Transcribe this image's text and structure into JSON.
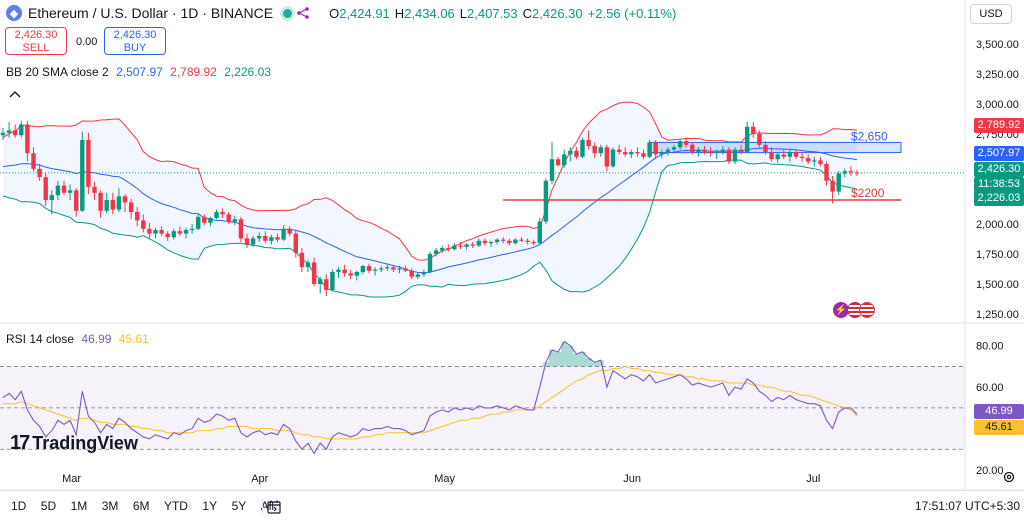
{
  "header": {
    "symbol_title": "Ethereum / U.S. Dollar · 1D · BINANCE",
    "open_label": "O",
    "open_value": "2,424.91",
    "high_label": "H",
    "high_value": "2,434.06",
    "low_label": "L",
    "low_value": "2,407.53",
    "close_label": "C",
    "close_value": "2,426.30",
    "change": "+2.56 (+0.11%)"
  },
  "trade": {
    "sell_price": "2,426.30",
    "sell_label": "SELL",
    "spread": "0.00",
    "buy_price": "2,426.30",
    "buy_label": "BUY"
  },
  "currency": "USD",
  "indicators": {
    "bb_label": "BB 20 SMA close 2",
    "bb_basis": "2,507.97",
    "bb_upper": "2,789.92",
    "bb_lower": "2,226.03",
    "rsi_label": "RSI 14 close",
    "rsi_value": "46.99",
    "rsi_ma": "45.61"
  },
  "price_tags": {
    "upper": "2,789.92",
    "basis": "2,507.97",
    "last": "2,426.30",
    "countdown": "11:38:53",
    "lower": "2,226.03"
  },
  "annotations": {
    "resistance": "$2,650",
    "support": "$2200"
  },
  "price_axis": [
    "3,500.00",
    "3,250.00",
    "3,000.00",
    "2,750.00",
    "2,250.00",
    "2,000.00",
    "1,750.00",
    "1,500.00",
    "1,250.00"
  ],
  "rsi_axis": [
    "80.00",
    "60.00",
    "20.00"
  ],
  "time_axis": [
    "Mar",
    "Apr",
    "May",
    "Jun",
    "Jul"
  ],
  "ranges": [
    "1D",
    "5D",
    "1M",
    "3M",
    "6M",
    "YTD",
    "1Y",
    "5Y",
    "All"
  ],
  "clock": "17:51:07 UTC+5:30",
  "branding": "TradingView",
  "colors": {
    "up": "#089981",
    "down": "#f23645",
    "basis": "#2962ff",
    "upper_band": "#f23645",
    "lower_band": "#089981",
    "rsi": "#7e57c2",
    "rsi_ma": "#fbc02d"
  },
  "chart_data": [
    {
      "type": "candlestick",
      "title": "Ethereum / U.S. Dollar · 1D · BINANCE",
      "ylim": [
        1200,
        3700
      ],
      "x_ticks": [
        "Mar",
        "Apr",
        "May",
        "Jun",
        "Jul"
      ],
      "start_date": "2024-02-18",
      "ohlc": [
        [
          2740,
          2800,
          2700,
          2760
        ],
        [
          2760,
          2850,
          2720,
          2780
        ],
        [
          2780,
          2830,
          2720,
          2740
        ],
        [
          2740,
          2860,
          2720,
          2830
        ],
        [
          2830,
          2860,
          2520,
          2590
        ],
        [
          2590,
          2640,
          2440,
          2460
        ],
        [
          2460,
          2500,
          2360,
          2390
        ],
        [
          2390,
          2420,
          2150,
          2200
        ],
        [
          2200,
          2280,
          2080,
          2240
        ],
        [
          2240,
          2360,
          2200,
          2320
        ],
        [
          2320,
          2360,
          2240,
          2260
        ],
        [
          2260,
          2330,
          2200,
          2280
        ],
        [
          2280,
          2300,
          2060,
          2110
        ],
        [
          2110,
          2770,
          2100,
          2700
        ],
        [
          2700,
          2760,
          2250,
          2310
        ],
        [
          2310,
          2350,
          2200,
          2260
        ],
        [
          2260,
          2280,
          2050,
          2110
        ],
        [
          2110,
          2260,
          2090,
          2200
        ],
        [
          2200,
          2260,
          2080,
          2120
        ],
        [
          2120,
          2300,
          2100,
          2230
        ],
        [
          2230,
          2250,
          2100,
          2180
        ],
        [
          2180,
          2210,
          2040,
          2100
        ],
        [
          2100,
          2140,
          1980,
          2030
        ],
        [
          2030,
          2080,
          1930,
          1960
        ],
        [
          1960,
          2010,
          1880,
          1920
        ],
        [
          1920,
          1970,
          1880,
          1950
        ],
        [
          1950,
          1980,
          1900,
          1920
        ],
        [
          1920,
          1940,
          1860,
          1890
        ],
        [
          1890,
          1960,
          1870,
          1940
        ],
        [
          1940,
          1980,
          1900,
          1920
        ],
        [
          1920,
          1970,
          1880,
          1950
        ],
        [
          1950,
          2000,
          1920,
          1960
        ],
        [
          1960,
          2080,
          1950,
          2060
        ],
        [
          2060,
          2080,
          1990,
          2010
        ],
        [
          2010,
          2060,
          1980,
          2050
        ],
        [
          2050,
          2120,
          2040,
          2100
        ],
        [
          2100,
          2130,
          2050,
          2080
        ],
        [
          2080,
          2100,
          2000,
          2020
        ],
        [
          2020,
          2070,
          1990,
          2040
        ],
        [
          2040,
          2060,
          1850,
          1880
        ],
        [
          1880,
          1920,
          1800,
          1830
        ],
        [
          1830,
          1900,
          1810,
          1880
        ],
        [
          1880,
          1930,
          1850,
          1900
        ],
        [
          1900,
          1940,
          1840,
          1860
        ],
        [
          1860,
          1910,
          1830,
          1890
        ],
        [
          1890,
          1920,
          1850,
          1870
        ],
        [
          1870,
          1990,
          1860,
          1960
        ],
        [
          1960,
          1980,
          1900,
          1920
        ],
        [
          1920,
          1950,
          1720,
          1760
        ],
        [
          1760,
          1800,
          1600,
          1640
        ],
        [
          1640,
          1700,
          1600,
          1680
        ],
        [
          1680,
          1720,
          1480,
          1500
        ],
        [
          1500,
          1560,
          1420,
          1540
        ],
        [
          1540,
          1580,
          1400,
          1450
        ],
        [
          1450,
          1620,
          1440,
          1600
        ],
        [
          1600,
          1640,
          1550,
          1620
        ],
        [
          1620,
          1660,
          1560,
          1590
        ],
        [
          1590,
          1620,
          1540,
          1570
        ],
        [
          1570,
          1610,
          1530,
          1600
        ],
        [
          1600,
          1660,
          1580,
          1650
        ],
        [
          1650,
          1670,
          1590,
          1610
        ],
        [
          1610,
          1640,
          1570,
          1620
        ],
        [
          1620,
          1650,
          1600,
          1630
        ],
        [
          1630,
          1660,
          1610,
          1640
        ],
        [
          1640,
          1660,
          1600,
          1620
        ],
        [
          1620,
          1650,
          1590,
          1630
        ],
        [
          1630,
          1650,
          1600,
          1610
        ],
        [
          1610,
          1630,
          1540,
          1560
        ],
        [
          1560,
          1600,
          1540,
          1580
        ],
        [
          1580,
          1620,
          1560,
          1600
        ],
        [
          1600,
          1770,
          1590,
          1750
        ],
        [
          1750,
          1800,
          1730,
          1780
        ],
        [
          1780,
          1820,
          1760,
          1800
        ],
        [
          1800,
          1830,
          1770,
          1790
        ],
        [
          1790,
          1840,
          1780,
          1820
        ],
        [
          1820,
          1850,
          1790,
          1810
        ],
        [
          1810,
          1840,
          1790,
          1830
        ],
        [
          1830,
          1850,
          1800,
          1820
        ],
        [
          1820,
          1880,
          1810,
          1860
        ],
        [
          1860,
          1880,
          1820,
          1840
        ],
        [
          1840,
          1860,
          1810,
          1850
        ],
        [
          1850,
          1880,
          1830,
          1870
        ],
        [
          1870,
          1890,
          1840,
          1860
        ],
        [
          1860,
          1880,
          1820,
          1840
        ],
        [
          1840,
          1880,
          1830,
          1870
        ],
        [
          1870,
          1890,
          1850,
          1860
        ],
        [
          1860,
          1880,
          1830,
          1850
        ],
        [
          1850,
          1870,
          1820,
          1840
        ],
        [
          1840,
          2050,
          1830,
          2020
        ],
        [
          2020,
          2380,
          2000,
          2360
        ],
        [
          2360,
          2680,
          2330,
          2540
        ],
        [
          2540,
          2560,
          2480,
          2490
        ],
        [
          2490,
          2620,
          2470,
          2580
        ],
        [
          2580,
          2640,
          2520,
          2610
        ],
        [
          2610,
          2640,
          2540,
          2560
        ],
        [
          2560,
          2720,
          2550,
          2700
        ],
        [
          2700,
          2780,
          2620,
          2650
        ],
        [
          2650,
          2680,
          2550,
          2590
        ],
        [
          2590,
          2660,
          2560,
          2640
        ],
        [
          2640,
          2660,
          2440,
          2480
        ],
        [
          2480,
          2640,
          2470,
          2620
        ],
        [
          2620,
          2660,
          2580,
          2600
        ],
        [
          2600,
          2640,
          2560,
          2580
        ],
        [
          2580,
          2620,
          2550,
          2600
        ],
        [
          2600,
          2640,
          2560,
          2590
        ],
        [
          2590,
          2620,
          2540,
          2560
        ],
        [
          2560,
          2700,
          2550,
          2680
        ],
        [
          2680,
          2700,
          2540,
          2580
        ],
        [
          2580,
          2620,
          2550,
          2600
        ],
        [
          2600,
          2640,
          2570,
          2620
        ],
        [
          2620,
          2660,
          2600,
          2640
        ],
        [
          2640,
          2700,
          2620,
          2690
        ],
        [
          2690,
          2720,
          2640,
          2660
        ],
        [
          2660,
          2680,
          2580,
          2600
        ],
        [
          2600,
          2640,
          2560,
          2620
        ],
        [
          2620,
          2650,
          2580,
          2600
        ],
        [
          2600,
          2640,
          2560,
          2590
        ],
        [
          2590,
          2620,
          2540,
          2600
        ],
        [
          2600,
          2650,
          2580,
          2620
        ],
        [
          2620,
          2640,
          2500,
          2520
        ],
        [
          2520,
          2640,
          2500,
          2620
        ],
        [
          2620,
          2660,
          2580,
          2600
        ],
        [
          2600,
          2850,
          2590,
          2810
        ],
        [
          2810,
          2850,
          2720,
          2750
        ],
        [
          2750,
          2780,
          2640,
          2660
        ],
        [
          2660,
          2690,
          2580,
          2600
        ],
        [
          2600,
          2640,
          2520,
          2540
        ],
        [
          2540,
          2600,
          2510,
          2580
        ],
        [
          2580,
          2620,
          2540,
          2560
        ],
        [
          2560,
          2620,
          2520,
          2600
        ],
        [
          2600,
          2620,
          2540,
          2560
        ],
        [
          2560,
          2600,
          2520,
          2550
        ],
        [
          2550,
          2580,
          2500,
          2520
        ],
        [
          2520,
          2560,
          2480,
          2530
        ],
        [
          2530,
          2560,
          2480,
          2500
        ],
        [
          2500,
          2520,
          2320,
          2360
        ],
        [
          2360,
          2400,
          2170,
          2270
        ],
        [
          2270,
          2440,
          2240,
          2420
        ],
        [
          2420,
          2460,
          2390,
          2440
        ],
        [
          2440,
          2480,
          2400,
          2430
        ],
        [
          2430,
          2450,
          2400,
          2426
        ]
      ],
      "bollinger": {
        "upper_last": 2789.92,
        "basis_last": 2507.97,
        "lower_last": 2226.03
      },
      "annotations": [
        {
          "label": "$2,650",
          "y_range": [
            2595,
            2680
          ],
          "type": "zone"
        },
        {
          "label": "$2200",
          "y": 2200,
          "type": "line"
        }
      ]
    },
    {
      "type": "line",
      "title": "RSI 14 close",
      "ylim": [
        20,
        90
      ],
      "y_ticks": [
        80,
        60,
        20
      ],
      "bands": [
        70,
        50,
        30
      ],
      "series": [
        {
          "name": "RSI",
          "values": [
            55,
            57,
            54,
            58,
            49,
            44,
            41,
            36,
            39,
            44,
            42,
            44,
            37,
            58,
            46,
            43,
            38,
            42,
            40,
            45,
            43,
            40,
            38,
            36,
            35,
            37,
            36,
            35,
            38,
            37,
            39,
            40,
            45,
            43,
            44,
            47,
            46,
            44,
            45,
            38,
            36,
            38,
            39,
            37,
            38,
            37,
            42,
            40,
            34,
            30,
            33,
            28,
            33,
            30,
            36,
            38,
            37,
            36,
            37,
            40,
            39,
            40,
            40,
            41,
            40,
            40,
            39,
            37,
            38,
            39,
            46,
            48,
            49,
            48,
            50,
            49,
            50,
            49,
            51,
            50,
            50,
            51,
            50,
            49,
            51,
            50,
            49,
            49,
            60,
            72,
            78,
            77,
            82,
            80,
            76,
            77,
            74,
            72,
            73,
            60,
            68,
            66,
            64,
            66,
            65,
            63,
            66,
            62,
            63,
            64,
            65,
            66,
            64,
            61,
            62,
            61,
            60,
            61,
            62,
            56,
            60,
            59,
            64,
            62,
            58,
            56,
            53,
            55,
            54,
            56,
            54,
            53,
            52,
            52,
            51,
            44,
            40,
            48,
            50,
            50,
            47
          ]
        },
        {
          "name": "RSI-based MA",
          "values": [
            52,
            52,
            52,
            53,
            52,
            51,
            50,
            49,
            48,
            47,
            46,
            45,
            44,
            45,
            45,
            44,
            43,
            43,
            42,
            42,
            42,
            41,
            41,
            40,
            40,
            39,
            39,
            38,
            38,
            38,
            38,
            38,
            39,
            39,
            39,
            40,
            40,
            41,
            41,
            41,
            41,
            40,
            40,
            40,
            40,
            39,
            39,
            39,
            38,
            37,
            37,
            36,
            36,
            35,
            35,
            35,
            35,
            35,
            35,
            36,
            36,
            37,
            37,
            38,
            38,
            38,
            38,
            38,
            38,
            38,
            39,
            40,
            41,
            42,
            43,
            44,
            44,
            45,
            45,
            46,
            47,
            47,
            48,
            48,
            49,
            49,
            49,
            49,
            51,
            53,
            55,
            57,
            59,
            61,
            63,
            64,
            66,
            67,
            68,
            68,
            69,
            69,
            70,
            69,
            69,
            68,
            68,
            67,
            67,
            66,
            66,
            66,
            65,
            65,
            64,
            64,
            63,
            63,
            63,
            62,
            62,
            62,
            62,
            61,
            61,
            60,
            60,
            59,
            58,
            58,
            57,
            56,
            56,
            55,
            54,
            53,
            52,
            51,
            50,
            49,
            46
          ]
        }
      ]
    }
  ]
}
